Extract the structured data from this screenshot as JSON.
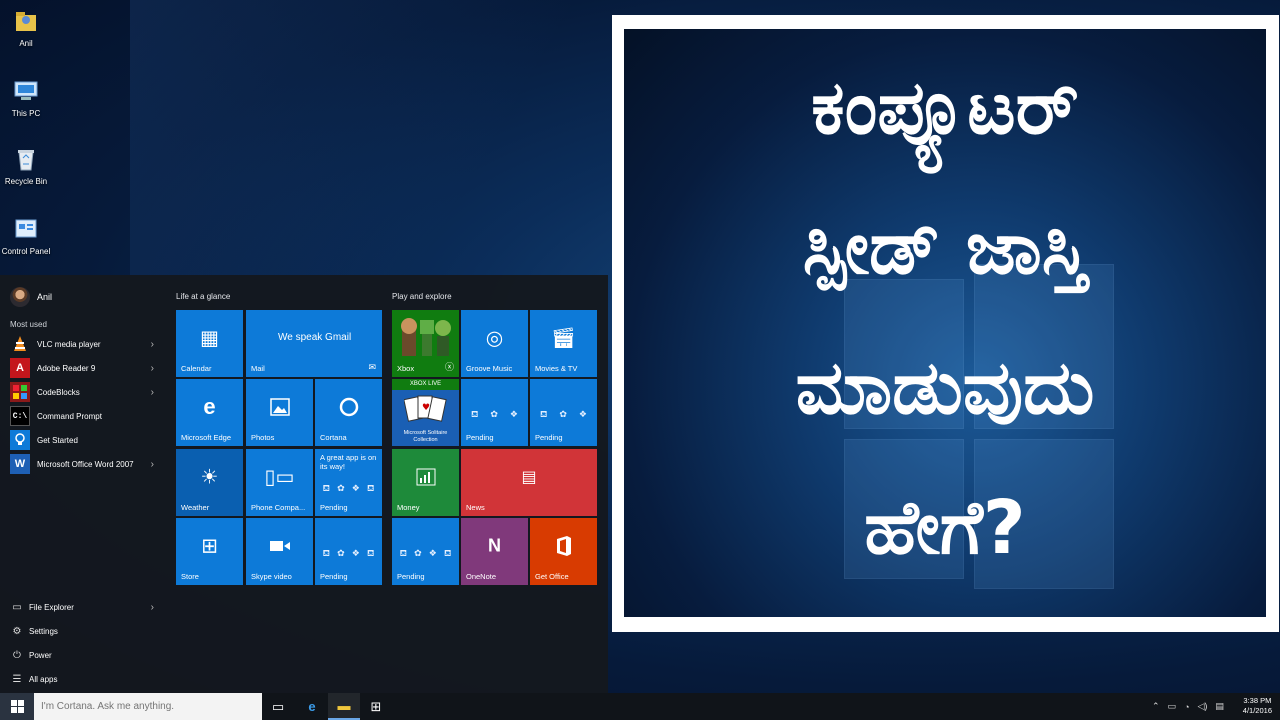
{
  "desktop": {
    "icons": [
      {
        "label": "Anil",
        "icon": "user-folder-icon"
      },
      {
        "label": "This PC",
        "icon": "computer-icon"
      },
      {
        "label": "Recycle Bin",
        "icon": "recycle-bin-icon"
      },
      {
        "label": "Control Panel",
        "icon": "control-panel-icon"
      }
    ]
  },
  "start_menu": {
    "user_name": "Anil",
    "most_used_label": "Most used",
    "most_used": [
      {
        "label": "VLC media player",
        "icon": "vlc-icon",
        "color": "#f08c1e"
      },
      {
        "label": "Adobe Reader 9",
        "icon": "adobe-reader-icon",
        "color": "#c4161c"
      },
      {
        "label": "CodeBlocks",
        "icon": "codeblocks-icon",
        "color": "#c41d22"
      },
      {
        "label": "Command Prompt",
        "icon": "command-prompt-icon",
        "color": "#1c1c1c"
      },
      {
        "label": "Get Started",
        "icon": "lightbulb-icon",
        "color": "#0d7ad8"
      },
      {
        "label": "Microsoft Office Word 2007",
        "icon": "word-icon",
        "color": "#1e5fb4"
      }
    ],
    "bottom": [
      {
        "label": "File Explorer",
        "icon": "folder-icon"
      },
      {
        "label": "Settings",
        "icon": "gear-icon"
      },
      {
        "label": "Power",
        "icon": "power-icon"
      },
      {
        "label": "All apps",
        "icon": "list-icon"
      }
    ],
    "groups": {
      "life_at_a_glance": "Life at a glance",
      "play_and_explore": "Play and explore"
    },
    "tiles": {
      "calendar": "Calendar",
      "mail": "Mail",
      "mail_message": "We speak Gmail",
      "edge": "Microsoft Edge",
      "photos": "Photos",
      "cortana": "Cortana",
      "weather": "Weather",
      "phone": "Phone Compa...",
      "promo_text": "A great app is on its way!",
      "pending": "Pending",
      "store": "Store",
      "skype": "Skype video",
      "xbox": "Xbox",
      "groove": "Groove Music",
      "movies": "Movies & TV",
      "xbox_live": "XBOX LIVE",
      "solitaire": "Microsoft Solitaire Collection",
      "money": "Money",
      "news": "News",
      "onenote": "OneNote",
      "get_office": "Get Office"
    }
  },
  "thumbnail": {
    "lines": [
      "ಕಂಪ್ಯೂಟರ್",
      "ಸ್ಪೀಡ್ ಜಾಸ್ತಿ",
      "ಮಾಡುವುದು",
      "ಹೇಗೆ?"
    ]
  },
  "taskbar": {
    "search_placeholder": "I'm Cortana. Ask me anything.",
    "time": "3:38 PM",
    "date": "4/1/2016"
  },
  "colors": {
    "tile_blue": "#0d7ad8",
    "tile_dark_blue": "#0a5fb0",
    "xbox_green": "#107c10",
    "money_green": "#1e8a3a",
    "news_red": "#d13438",
    "onenote_purple": "#80397b",
    "office_orange": "#d83b01"
  }
}
